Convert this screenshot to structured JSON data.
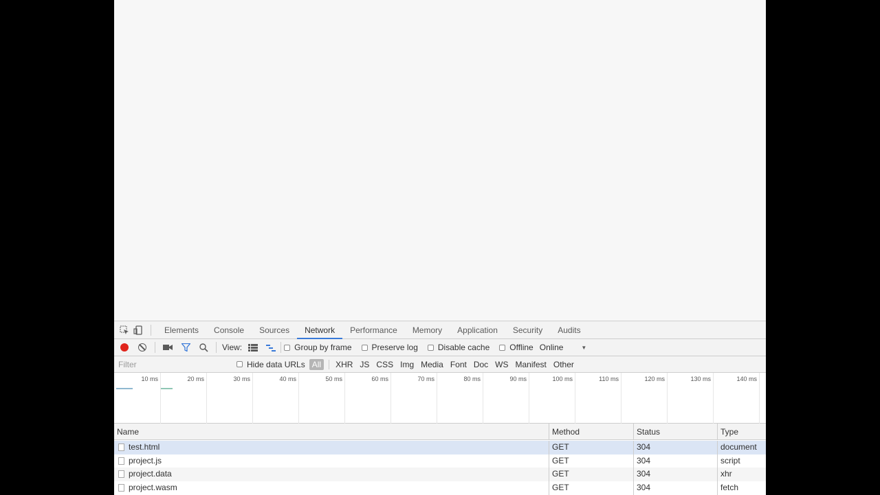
{
  "devtools": {
    "tabs": [
      "Elements",
      "Console",
      "Sources",
      "Network",
      "Performance",
      "Memory",
      "Application",
      "Security",
      "Audits"
    ],
    "active_tab": "Network"
  },
  "toolbar": {
    "view_label": "View:",
    "group_by_frame": "Group by frame",
    "preserve_log": "Preserve log",
    "disable_cache": "Disable cache",
    "offline": "Offline",
    "throttle": "Online"
  },
  "filterbar": {
    "placeholder": "Filter",
    "hide_data_urls": "Hide data URLs",
    "types": [
      "All",
      "XHR",
      "JS",
      "CSS",
      "Img",
      "Media",
      "Font",
      "Doc",
      "WS",
      "Manifest",
      "Other"
    ],
    "active_type": "All"
  },
  "overview": {
    "ticks": [
      "10 ms",
      "20 ms",
      "30 ms",
      "40 ms",
      "50 ms",
      "60 ms",
      "70 ms",
      "80 ms",
      "90 ms",
      "100 ms",
      "110 ms",
      "120 ms",
      "130 ms",
      "140 ms"
    ]
  },
  "table": {
    "headers": {
      "name": "Name",
      "method": "Method",
      "status": "Status",
      "type": "Type"
    },
    "rows": [
      {
        "name": "test.html",
        "method": "GET",
        "status": "304",
        "type": "document"
      },
      {
        "name": "project.js",
        "method": "GET",
        "status": "304",
        "type": "script"
      },
      {
        "name": "project.data",
        "method": "GET",
        "status": "304",
        "type": "xhr"
      },
      {
        "name": "project.wasm",
        "method": "GET",
        "status": "304",
        "type": "fetch"
      }
    ]
  },
  "colors": {
    "record": "#e0241b",
    "accent": "#3879d9",
    "selected_row": "#dbe5f5"
  }
}
